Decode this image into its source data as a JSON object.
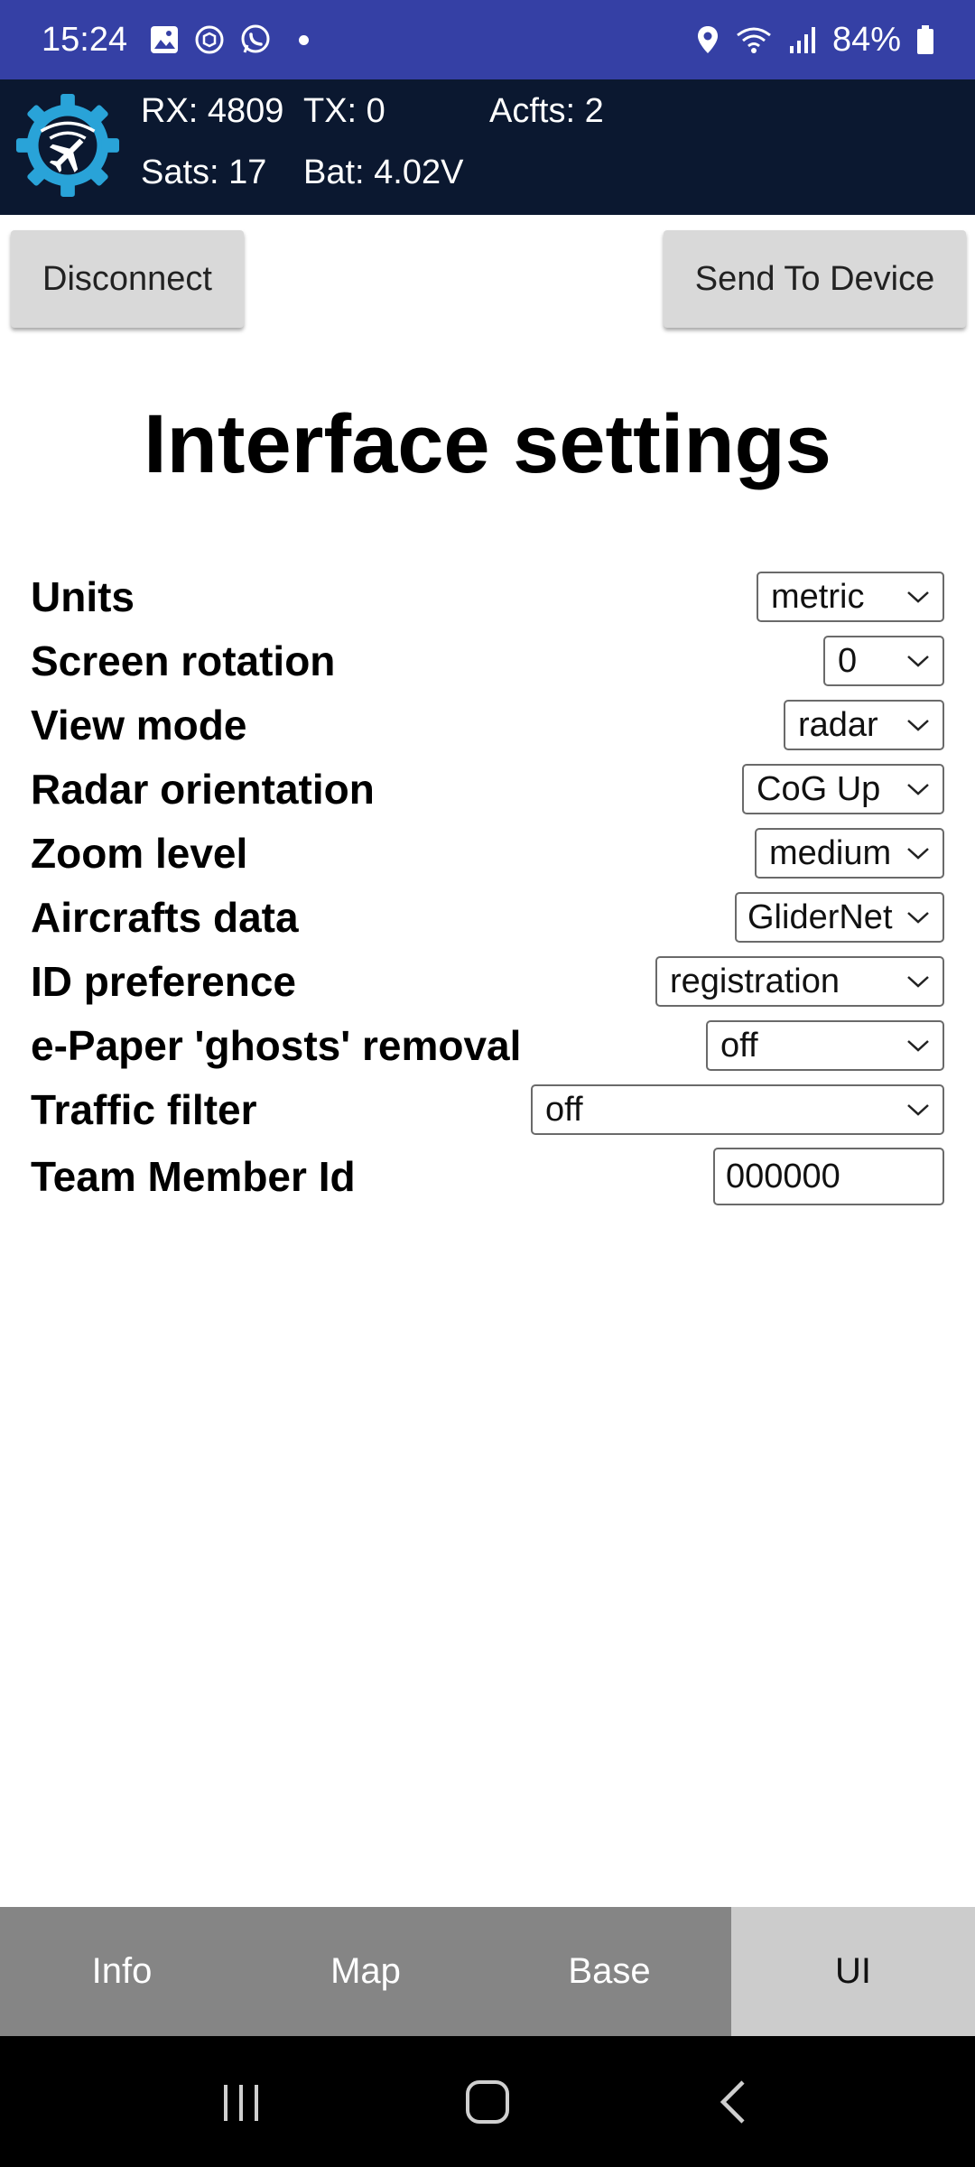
{
  "status_bar": {
    "time": "15:24",
    "battery": "84%",
    "icons": [
      "gallery-icon",
      "app-icon",
      "whatsapp-icon",
      "notification-dot",
      "location-icon",
      "wifi-icon",
      "signal-icon",
      "battery-icon"
    ]
  },
  "header": {
    "rx": "RX: 4809",
    "tx": "TX: 0",
    "acfts": "Acfts: 2",
    "sats": "Sats: 17",
    "bat": "Bat: 4.02V",
    "logo_color": "#29a3d8"
  },
  "toolbar": {
    "disconnect_label": "Disconnect",
    "send_label": "Send To Device"
  },
  "page": {
    "title": "Interface settings"
  },
  "settings": [
    {
      "label": "Units",
      "value": "metric"
    },
    {
      "label": "Screen rotation",
      "value": "0"
    },
    {
      "label": "View mode",
      "value": "radar"
    },
    {
      "label": "Radar orientation",
      "value": "CoG Up"
    },
    {
      "label": "Zoom level",
      "value": "medium"
    },
    {
      "label": "Aircrafts data",
      "value": "GliderNet"
    },
    {
      "label": "ID preference",
      "value": "registration"
    },
    {
      "label": "e-Paper 'ghosts' removal",
      "value": "off"
    },
    {
      "label": "Traffic filter",
      "value": "off"
    },
    {
      "label": "Team Member Id",
      "value": "000000"
    }
  ],
  "tabs": [
    {
      "label": "Info",
      "active": false
    },
    {
      "label": "Map",
      "active": false
    },
    {
      "label": "Base",
      "active": false
    },
    {
      "label": "UI",
      "active": true
    }
  ],
  "colors": {
    "status_bar": "#3540a5",
    "app_header": "#0b1830",
    "tab_bar": "#858585",
    "tab_active": "#cccccc"
  }
}
